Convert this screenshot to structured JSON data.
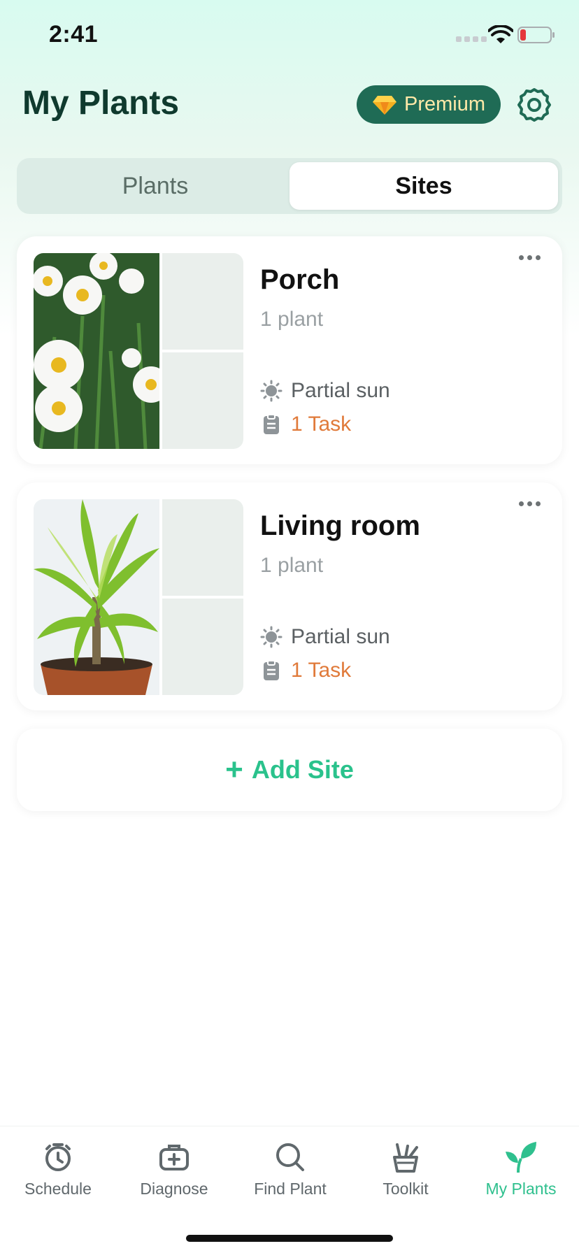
{
  "status_bar": {
    "time": "2:41"
  },
  "header": {
    "title": "My Plants",
    "premium_label": "Premium"
  },
  "segmented": {
    "tabs": [
      "Plants",
      "Sites"
    ],
    "selected": "Sites"
  },
  "sites": [
    {
      "name": "Porch",
      "count": "1 plant",
      "light": "Partial sun",
      "tasks": "1 Task"
    },
    {
      "name": "Living room",
      "count": "1 plant",
      "light": "Partial sun",
      "tasks": "1 Task"
    }
  ],
  "add_site": {
    "plus": "+",
    "label": "Add Site"
  },
  "tab_bar": {
    "items": [
      {
        "label": "Schedule",
        "icon": "alarm-clock-icon"
      },
      {
        "label": "Diagnose",
        "icon": "medical-kit-icon"
      },
      {
        "label": "Find Plant",
        "icon": "search-icon"
      },
      {
        "label": "Toolkit",
        "icon": "plant-pot-tools-icon"
      },
      {
        "label": "My Plants",
        "icon": "leaf-icon"
      }
    ],
    "active": "My Plants"
  },
  "colors": {
    "accent": "#2ac28c",
    "premium_bg": "#1f6b55",
    "task": "#e07a3a",
    "title": "#0f3a2e"
  }
}
